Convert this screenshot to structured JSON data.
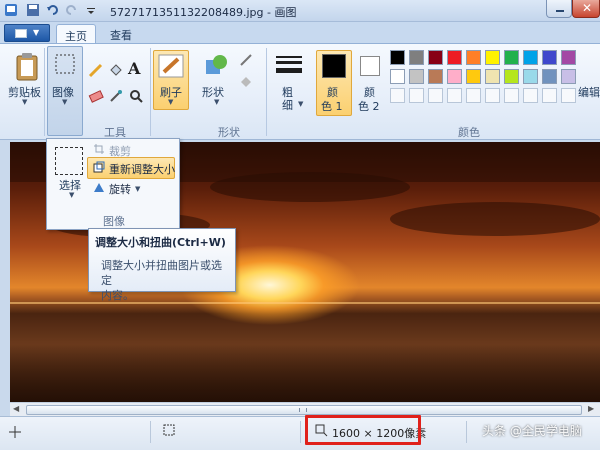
{
  "window": {
    "title": "57271713511322084 89.jpg - 画图",
    "title_display": "5727171351132208489.jpg - 画图"
  },
  "tabs": [
    {
      "label": "主页",
      "active": true
    },
    {
      "label": "查看",
      "active": false
    }
  ],
  "ribbon": {
    "clipboard_label": "剪贴板",
    "image_label": "图像",
    "tools_group_label": "工具",
    "brush_label": "刷子",
    "shapes_label": "形状",
    "shapes_group_label": "形状",
    "size_label_line1": "粗",
    "size_label_line2": "细",
    "color1_label_line1": "颜",
    "color1_label_line2": "色 1",
    "color2_label_line1": "颜",
    "color2_label_line2": "色 2",
    "colors_group_label": "颜色",
    "edit_colors_label": "编辑"
  },
  "palette_row1": [
    "#000000",
    "#7f7f7f",
    "#880015",
    "#ed1c24",
    "#ff7f27",
    "#fff200",
    "#22b14c",
    "#00a2e8",
    "#3f48cc",
    "#a349a4"
  ],
  "palette_row2": [
    "#ffffff",
    "#c3c3c3",
    "#b97a57",
    "#ffaec9",
    "#ffc90e",
    "#efe4b0",
    "#b5e61d",
    "#99d9ea",
    "#7092be",
    "#c8bfe7"
  ],
  "image_menu": {
    "select_label": "选择",
    "crop_label": "裁剪",
    "resize_label": "重新调整大小",
    "rotate_label": "旋转",
    "group_label": "图像"
  },
  "tooltip": {
    "title": "调整大小和扭曲(Ctrl+W)",
    "body_line1": "调整大小并扭曲图片或选定",
    "body_line2": "内容。"
  },
  "status": {
    "dimensions": "1600 × 1200像素",
    "zoom_partial": "%"
  },
  "watermark": "头条 @全民学电脑",
  "colors": {
    "highlight_red": "#e0211b",
    "accent_orange": "#fbd070"
  }
}
